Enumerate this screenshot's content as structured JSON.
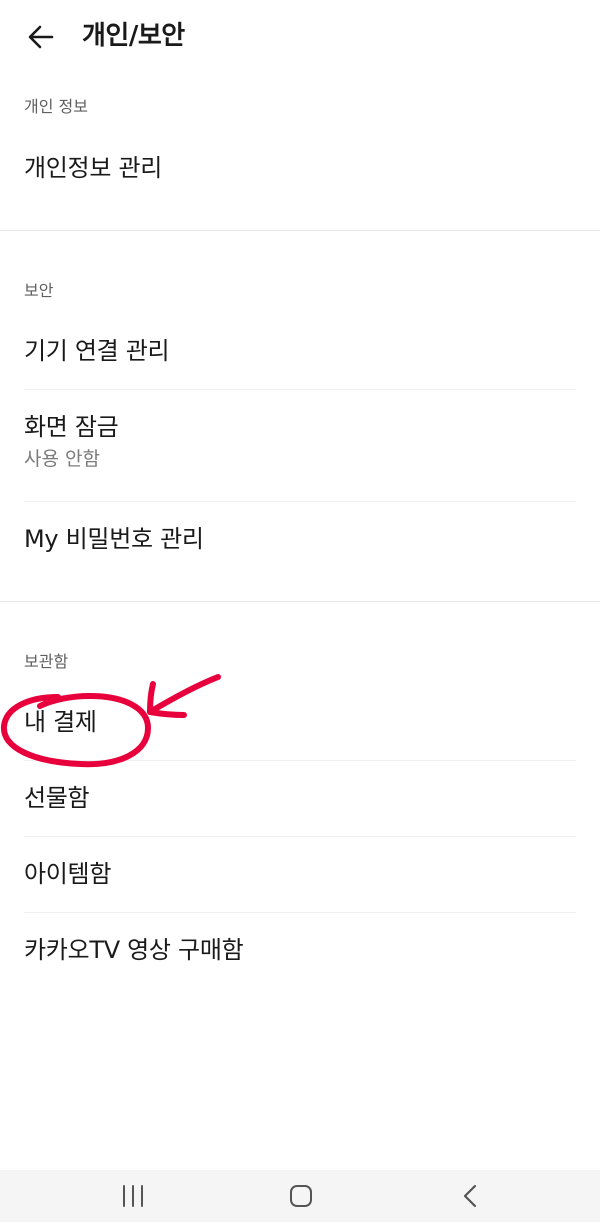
{
  "header": {
    "title": "개인/보안"
  },
  "sections": {
    "personal": {
      "label": "개인 정보",
      "items": [
        {
          "title": "개인정보 관리"
        }
      ]
    },
    "security": {
      "label": "보안",
      "items": [
        {
          "title": "기기 연결 관리"
        },
        {
          "title": "화면 잠금",
          "subtitle": "사용 안함"
        },
        {
          "title": "My 비밀번호 관리"
        }
      ]
    },
    "storage": {
      "label": "보관함",
      "items": [
        {
          "title": "내 결제"
        },
        {
          "title": "선물함"
        },
        {
          "title": "아이템함"
        },
        {
          "title": "카카오TV 영상 구매함"
        }
      ]
    }
  },
  "annotation": {
    "color": "#e8003c",
    "highlighted_item": "내 결제"
  },
  "navbar": {
    "icons": [
      "recent-apps-icon",
      "home-icon",
      "back-nav-icon"
    ]
  }
}
